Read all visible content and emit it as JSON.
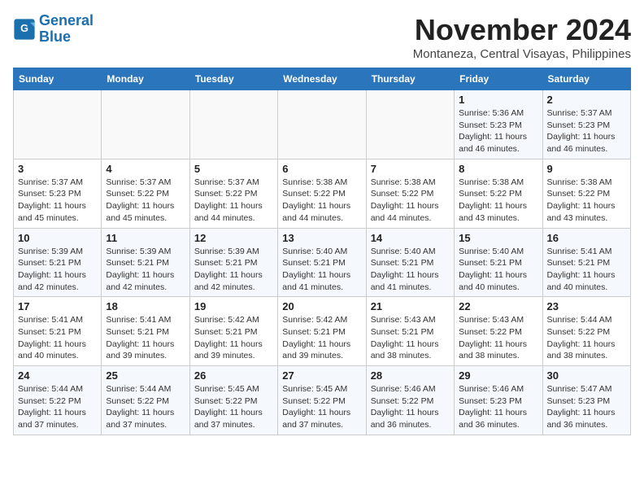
{
  "logo": {
    "line1": "General",
    "line2": "Blue"
  },
  "title": "November 2024",
  "location": "Montaneza, Central Visayas, Philippines",
  "days_of_week": [
    "Sunday",
    "Monday",
    "Tuesday",
    "Wednesday",
    "Thursday",
    "Friday",
    "Saturday"
  ],
  "weeks": [
    [
      {
        "num": "",
        "info": ""
      },
      {
        "num": "",
        "info": ""
      },
      {
        "num": "",
        "info": ""
      },
      {
        "num": "",
        "info": ""
      },
      {
        "num": "",
        "info": ""
      },
      {
        "num": "1",
        "info": "Sunrise: 5:36 AM\nSunset: 5:23 PM\nDaylight: 11 hours and 46 minutes."
      },
      {
        "num": "2",
        "info": "Sunrise: 5:37 AM\nSunset: 5:23 PM\nDaylight: 11 hours and 46 minutes."
      }
    ],
    [
      {
        "num": "3",
        "info": "Sunrise: 5:37 AM\nSunset: 5:23 PM\nDaylight: 11 hours and 45 minutes."
      },
      {
        "num": "4",
        "info": "Sunrise: 5:37 AM\nSunset: 5:22 PM\nDaylight: 11 hours and 45 minutes."
      },
      {
        "num": "5",
        "info": "Sunrise: 5:37 AM\nSunset: 5:22 PM\nDaylight: 11 hours and 44 minutes."
      },
      {
        "num": "6",
        "info": "Sunrise: 5:38 AM\nSunset: 5:22 PM\nDaylight: 11 hours and 44 minutes."
      },
      {
        "num": "7",
        "info": "Sunrise: 5:38 AM\nSunset: 5:22 PM\nDaylight: 11 hours and 44 minutes."
      },
      {
        "num": "8",
        "info": "Sunrise: 5:38 AM\nSunset: 5:22 PM\nDaylight: 11 hours and 43 minutes."
      },
      {
        "num": "9",
        "info": "Sunrise: 5:38 AM\nSunset: 5:22 PM\nDaylight: 11 hours and 43 minutes."
      }
    ],
    [
      {
        "num": "10",
        "info": "Sunrise: 5:39 AM\nSunset: 5:21 PM\nDaylight: 11 hours and 42 minutes."
      },
      {
        "num": "11",
        "info": "Sunrise: 5:39 AM\nSunset: 5:21 PM\nDaylight: 11 hours and 42 minutes."
      },
      {
        "num": "12",
        "info": "Sunrise: 5:39 AM\nSunset: 5:21 PM\nDaylight: 11 hours and 42 minutes."
      },
      {
        "num": "13",
        "info": "Sunrise: 5:40 AM\nSunset: 5:21 PM\nDaylight: 11 hours and 41 minutes."
      },
      {
        "num": "14",
        "info": "Sunrise: 5:40 AM\nSunset: 5:21 PM\nDaylight: 11 hours and 41 minutes."
      },
      {
        "num": "15",
        "info": "Sunrise: 5:40 AM\nSunset: 5:21 PM\nDaylight: 11 hours and 40 minutes."
      },
      {
        "num": "16",
        "info": "Sunrise: 5:41 AM\nSunset: 5:21 PM\nDaylight: 11 hours and 40 minutes."
      }
    ],
    [
      {
        "num": "17",
        "info": "Sunrise: 5:41 AM\nSunset: 5:21 PM\nDaylight: 11 hours and 40 minutes."
      },
      {
        "num": "18",
        "info": "Sunrise: 5:41 AM\nSunset: 5:21 PM\nDaylight: 11 hours and 39 minutes."
      },
      {
        "num": "19",
        "info": "Sunrise: 5:42 AM\nSunset: 5:21 PM\nDaylight: 11 hours and 39 minutes."
      },
      {
        "num": "20",
        "info": "Sunrise: 5:42 AM\nSunset: 5:21 PM\nDaylight: 11 hours and 39 minutes."
      },
      {
        "num": "21",
        "info": "Sunrise: 5:43 AM\nSunset: 5:21 PM\nDaylight: 11 hours and 38 minutes."
      },
      {
        "num": "22",
        "info": "Sunrise: 5:43 AM\nSunset: 5:22 PM\nDaylight: 11 hours and 38 minutes."
      },
      {
        "num": "23",
        "info": "Sunrise: 5:44 AM\nSunset: 5:22 PM\nDaylight: 11 hours and 38 minutes."
      }
    ],
    [
      {
        "num": "24",
        "info": "Sunrise: 5:44 AM\nSunset: 5:22 PM\nDaylight: 11 hours and 37 minutes."
      },
      {
        "num": "25",
        "info": "Sunrise: 5:44 AM\nSunset: 5:22 PM\nDaylight: 11 hours and 37 minutes."
      },
      {
        "num": "26",
        "info": "Sunrise: 5:45 AM\nSunset: 5:22 PM\nDaylight: 11 hours and 37 minutes."
      },
      {
        "num": "27",
        "info": "Sunrise: 5:45 AM\nSunset: 5:22 PM\nDaylight: 11 hours and 37 minutes."
      },
      {
        "num": "28",
        "info": "Sunrise: 5:46 AM\nSunset: 5:22 PM\nDaylight: 11 hours and 36 minutes."
      },
      {
        "num": "29",
        "info": "Sunrise: 5:46 AM\nSunset: 5:23 PM\nDaylight: 11 hours and 36 minutes."
      },
      {
        "num": "30",
        "info": "Sunrise: 5:47 AM\nSunset: 5:23 PM\nDaylight: 11 hours and 36 minutes."
      }
    ]
  ]
}
